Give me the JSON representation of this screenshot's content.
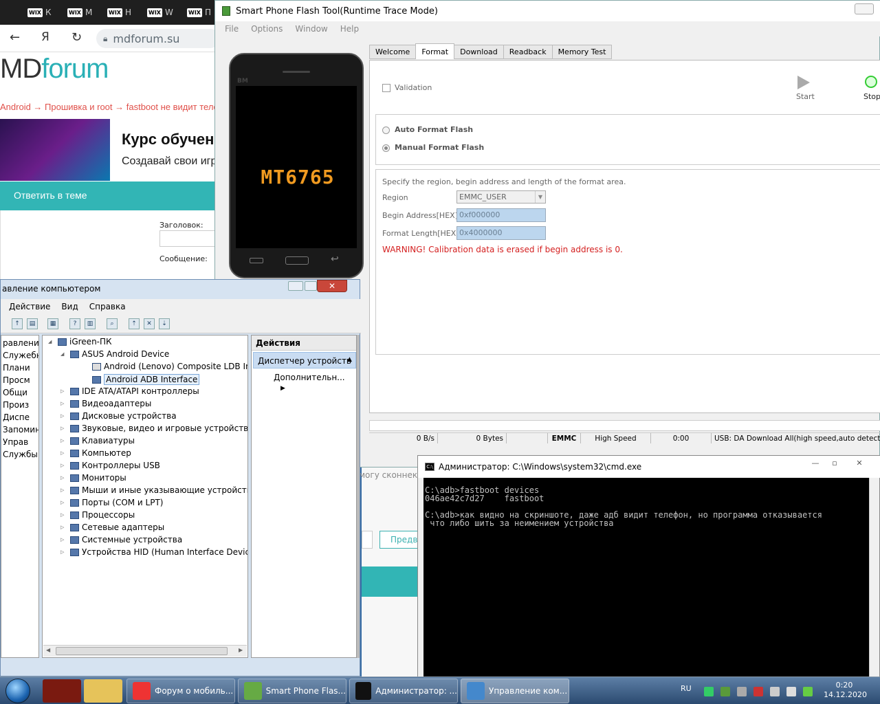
{
  "browser": {
    "tabs": [
      {
        "icon": "wix",
        "label": "К"
      },
      {
        "icon": "wix",
        "label": "M"
      },
      {
        "icon": "wix",
        "label": "H"
      },
      {
        "icon": "wix",
        "label": "W"
      },
      {
        "icon": "wix",
        "label": "П"
      }
    ],
    "url": "mdforum.su",
    "logo_a": "MD",
    "logo_b": "forum",
    "breadcrumb": "Android → Прошивка и root → fastboot не видит телефон",
    "banner_title": "Курс обучения",
    "banner_subtitle": "Создавай свои игры",
    "reply_button": "Ответить в теме",
    "subject_label": "Заголовок:",
    "message_label": "Сообщение:",
    "behind_text": "могу сконнек",
    "behind_button": "Предва"
  },
  "flash_tool": {
    "title": "Smart Phone Flash Tool(Runtime Trace Mode)",
    "menu": [
      "File",
      "Options",
      "Window",
      "Help"
    ],
    "phone_model": "MT6765",
    "phone_brand": "BM",
    "tabs": [
      "Welcome",
      "Format",
      "Download",
      "Readback",
      "Memory Test"
    ],
    "active_tab": "Format",
    "validation_label": "Validation",
    "start_label": "Start",
    "stop_label": "Stop",
    "auto_format": "Auto Format Flash",
    "manual_format": "Manual Format Flash",
    "specify_text": "Specify the region, begin address and length of the format area.",
    "region_label": "Region",
    "region_value": "EMMC_USER",
    "begin_label": "Begin Address[HEX]:",
    "begin_value": "0xf000000",
    "length_label": "Format Length[HEX]:",
    "length_value": "0x4000000",
    "warning": "WARNING! Calibration data is erased if begin address is 0.",
    "status": {
      "speed": "0 B/s",
      "bytes": "0 Bytes",
      "blank": "",
      "storage": "EMMC",
      "mode": "High Speed",
      "time": "0:00",
      "usb": "USB: DA Download All(high speed,auto detect)"
    }
  },
  "cmd": {
    "title": "Администратор: C:\\Windows\\system32\\cmd.exe",
    "output": "C:\\adb>fastboot devices\n046ae42c7d27    fastboot\n\nC:\\adb>как видно на скриншоте, даже адб видит телефон, но программа отказывается\n что либо шить за неимением устройства"
  },
  "mgmt": {
    "title": "авление компьютером",
    "menu": [
      "Действие",
      "Вид",
      "Справка"
    ],
    "left_tree": [
      "равление к",
      "Служебн",
      "Плани",
      "Просм",
      "Общи",
      "Произ",
      "Диспе",
      "Запомина",
      "Управ",
      "Службы и"
    ],
    "device_tree": {
      "root": "iGreen-ПК",
      "items": [
        {
          "label": "ASUS Android Device",
          "level": 1,
          "expanded": true
        },
        {
          "label": "Android (Lenovo) Composite LDB Interface",
          "level": 2,
          "warn": true
        },
        {
          "label": "Android ADB Interface",
          "level": 2,
          "selected": true
        },
        {
          "label": "IDE ATA/ATAPI контроллеры",
          "level": 1
        },
        {
          "label": "Видеоадаптеры",
          "level": 1
        },
        {
          "label": "Дисковые устройства",
          "level": 1
        },
        {
          "label": "Звуковые, видео и игровые устройства",
          "level": 1
        },
        {
          "label": "Клавиатуры",
          "level": 1
        },
        {
          "label": "Компьютер",
          "level": 1
        },
        {
          "label": "Контроллеры USB",
          "level": 1
        },
        {
          "label": "Мониторы",
          "level": 1
        },
        {
          "label": "Мыши и иные указывающие устройства",
          "level": 1
        },
        {
          "label": "Порты (COM и LPT)",
          "level": 1
        },
        {
          "label": "Процессоры",
          "level": 1
        },
        {
          "label": "Сетевые адаптеры",
          "level": 1
        },
        {
          "label": "Системные устройства",
          "level": 1
        },
        {
          "label": "Устройства HID (Human Interface Devices)",
          "level": 1
        }
      ]
    },
    "actions_header": "Действия",
    "actions_selected": "Диспетчер устройств",
    "actions_more": "Дополнительн..."
  },
  "taskbar": {
    "items": [
      {
        "label": "Форум о мобиль...",
        "icon": "yandex-browser-icon"
      },
      {
        "label": "Smart Phone Flas...",
        "icon": "flash-tool-icon"
      },
      {
        "label": "Администратор: ...",
        "icon": "cmd-icon"
      },
      {
        "label": "Управление ком...",
        "icon": "computer-management-icon"
      }
    ],
    "lang": "RU",
    "time": "0:20",
    "date": "14.12.2020"
  }
}
